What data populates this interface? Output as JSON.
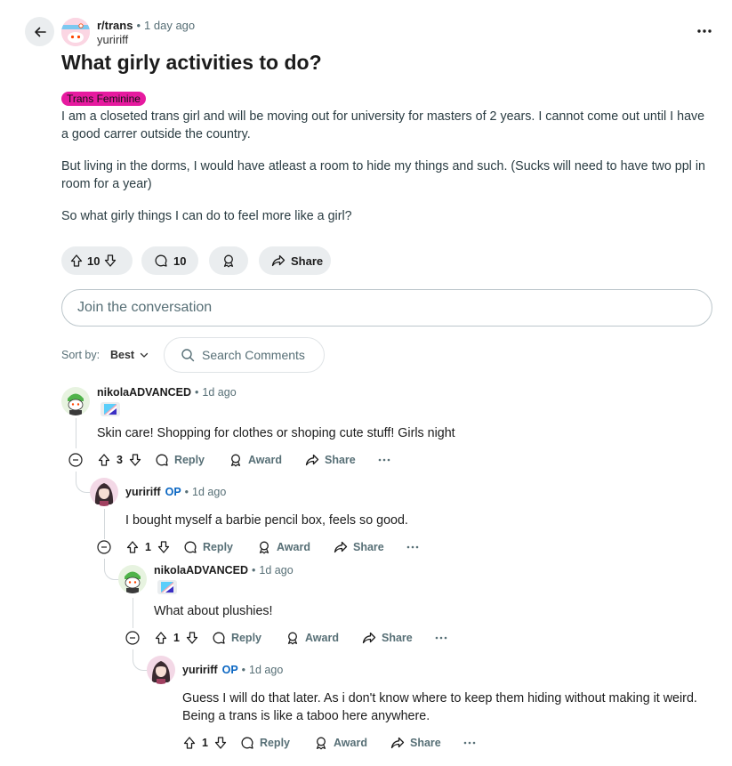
{
  "post": {
    "subreddit": "r/trans",
    "time": "1 day ago",
    "author": "yuririff",
    "title": "What girly activities to do?",
    "flair": "Trans Feminine",
    "body": [
      "I am a closeted trans girl and will be moving out for university for masters of 2 years. I cannot come out until I have a good carrer outside the country.",
      "But living in the dorms, I would have atleast a room to hide my things and such. (Sucks will need to have two ppl in room for a year)",
      "So what girly things I can do to feel more like a girl?"
    ],
    "votes": "10",
    "comments": "10",
    "share_label": "Share"
  },
  "composer": {
    "placeholder": "Join the conversation"
  },
  "sort": {
    "label": "Sort by:",
    "value": "Best"
  },
  "search": {
    "placeholder": "Search Comments"
  },
  "comments": [
    {
      "author": "nikolaADVANCED",
      "time": "1d ago",
      "text": "Skin care! Shopping for clothes or shoping cute stuff! Girls night",
      "votes": "3",
      "reply": "Reply",
      "award": "Award",
      "share": "Share"
    },
    {
      "author": "yuririff",
      "op": "OP",
      "time": "1d ago",
      "text": "I bought myself a barbie pencil box, feels so good.",
      "votes": "1",
      "reply": "Reply",
      "award": "Award",
      "share": "Share"
    },
    {
      "author": "nikolaADVANCED",
      "time": "1d ago",
      "text": "What about plushies!",
      "votes": "1",
      "reply": "Reply",
      "award": "Award",
      "share": "Share"
    },
    {
      "author": "yuririff",
      "op": "OP",
      "time": "1d ago",
      "text": "Guess I will do that later. As i don't know where to keep them hiding without making it weird. Being a trans is like a taboo here anywhere.",
      "votes": "1",
      "reply": "Reply",
      "award": "Award",
      "share": "Share"
    }
  ],
  "colors": {
    "flair_bg": "#e61a9f",
    "op": "#0a66c2",
    "pill_bg": "#eaedef"
  }
}
